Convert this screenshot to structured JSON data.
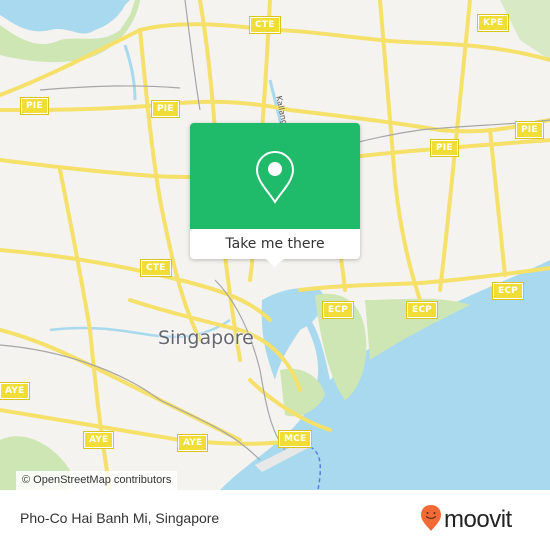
{
  "map": {
    "city_label": "Singapore",
    "street_label": "Kallang R",
    "road_shields": [
      {
        "id": "cte-north",
        "label": "CTE"
      },
      {
        "id": "kpe",
        "label": "KPE"
      },
      {
        "id": "pie-west",
        "label": "PIE"
      },
      {
        "id": "pie-center",
        "label": "PIE"
      },
      {
        "id": "pie-east",
        "label": "PIE"
      },
      {
        "id": "pie-mid-east",
        "label": "PIE"
      },
      {
        "id": "cte-center",
        "label": "CTE"
      },
      {
        "id": "ecp-1",
        "label": "ECP"
      },
      {
        "id": "ecp-2",
        "label": "ECP"
      },
      {
        "id": "ecp-3",
        "label": "ECP"
      },
      {
        "id": "aye-west",
        "label": "AYE"
      },
      {
        "id": "aye-1",
        "label": "AYE"
      },
      {
        "id": "aye-2",
        "label": "AYE"
      },
      {
        "id": "mce",
        "label": "MCE"
      }
    ],
    "attribution": "© OpenStreetMap contributors",
    "colors": {
      "land": "#f4f3ef",
      "water": "#a8d9ee",
      "park": "#cde6b4",
      "road": "#f5e06a",
      "shield": "#f1dd38"
    }
  },
  "popup": {
    "icon": "map-pin-icon",
    "button_label": "Take me there",
    "color": "#1fbb6b"
  },
  "footer": {
    "title": "Pho-Co Hai Banh Mi, Singapore",
    "brand": "moovit",
    "brand_color": "#f26a35"
  }
}
